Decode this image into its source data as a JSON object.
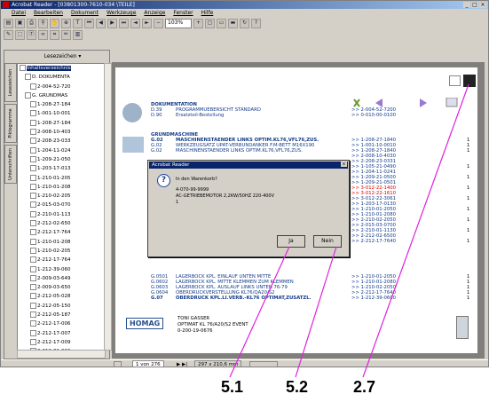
{
  "window": {
    "title": "Acrobat Reader - [03801300-7610-034 \\TEILE]",
    "controls": [
      "_",
      "□",
      "×"
    ]
  },
  "menu": [
    "Datei",
    "Bearbeiten",
    "Dokument",
    "Werkzeuge",
    "Anzeige",
    "Fenster",
    "Hilfe"
  ],
  "toolbar": {
    "zoom": "103%"
  },
  "sidebar": {
    "header": "Lesezeichen ▾",
    "tabs": [
      "Lesezeichen",
      "Piktogramme",
      "Unterschriften"
    ],
    "tree": [
      {
        "label": "Inhaltsverzeichnis",
        "selected": true
      },
      {
        "label": "D. DOKUMENTA"
      },
      {
        "label": "2-004-52-720"
      },
      {
        "label": "G. GRUNDMAS"
      },
      {
        "label": "1-208-27-184"
      },
      {
        "label": "1-001-10-001"
      },
      {
        "label": "1-208-27-184"
      },
      {
        "label": "2-008-10-403"
      },
      {
        "label": "2-208-23-033"
      },
      {
        "label": "1-204-11-024"
      },
      {
        "label": "1-209-21-050"
      },
      {
        "label": "1-203-17-013"
      },
      {
        "label": "1-210-01-205"
      },
      {
        "label": "1-210-01-208"
      },
      {
        "label": "1-210-02-205"
      },
      {
        "label": "2-015-03-070"
      },
      {
        "label": "2-210-01-113"
      },
      {
        "label": "2-212-02-650"
      },
      {
        "label": "2-212-17-764"
      },
      {
        "label": "1-210-01-208"
      },
      {
        "label": "1-210-02-205"
      },
      {
        "label": "2-212-17-764"
      },
      {
        "label": "1-212-39-060"
      },
      {
        "label": "2-009-03-649"
      },
      {
        "label": "2-009-03-650"
      },
      {
        "label": "2-212-05-028"
      },
      {
        "label": "2-212-05-150"
      },
      {
        "label": "2-212-05-187"
      },
      {
        "label": "2-212-17-006"
      },
      {
        "label": "2-212-17-007"
      },
      {
        "label": "2-212-17-009"
      },
      {
        "label": "2-212-31-002"
      },
      {
        "label": "2-212-31-189"
      }
    ]
  },
  "document": {
    "dok_header": "DOKUMENTATION",
    "dok_rows": [
      {
        "code": "D.39",
        "text": "PROGRAMMUEBERSICHT STANDARD",
        "ref": ">> 2-004-52-7200"
      },
      {
        "code": "D.90",
        "text": "Ersatzteil-Bestellung",
        "ref": ">> 0-010-00-0100"
      }
    ],
    "grund_header": "GRUNDMASCHINE",
    "grund_rows": [
      {
        "code": "G.02",
        "text": "MASCHINENSTAENDER LINKS  OPTIM.KL76,VFL76,ZUS.",
        "ref": ">> 1-208-27-1840",
        "qty": "1",
        "bold": true
      },
      {
        "code": "G.02",
        "text": "WERKZEUGSATZ UPAT-VERBUNDANKER F.M-BETT M16X190",
        "ref": ">> 1-001-10-0010",
        "qty": "1"
      },
      {
        "code": "G.02",
        "text": "MASCHINENSTAENDER LINKS  OPTIM.KL76,VFL76,ZUS.",
        "ref": ">> 1-208-27-1840",
        "qty": "1"
      }
    ],
    "right_refs": [
      ">> 2-008-10-4030",
      ">> 2-208-23-0331",
      ">> 1-105-21-0490",
      ">> 1-204-11-0241",
      ">> 1-209-21-0500",
      ">> 1-209-21-0501",
      ">> 3-012-22-1400",
      ">> 3-012-22-1610",
      ">> 3-012-22-3061",
      ">> 1-203-17-0130",
      ">> 1-210-01-2050",
      ">> 1-210-01-2080",
      ">> 2-210-02-2050",
      ">> 2-015-03-0700",
      ">> 2-210-01-1130",
      ">> 2-212-02-6500",
      ">> 2-212-17-7640"
    ],
    "right_qtys": [
      "1",
      "1",
      "1",
      "1",
      "1",
      "1",
      "1",
      "1"
    ],
    "lower_rows": [
      {
        "code": "G.0501",
        "text": "LAGERBOCK KPL. EINLAUF  UNTEN MITTE",
        "ref": ">> 1-210-01-2050",
        "qty": "1"
      },
      {
        "code": "G.0602",
        "text": "LAGERBOCK KPL. MITTE    KLEMMEN ZUM KLEMMEN",
        "ref": ">> 1-210-01-2080",
        "qty": "1"
      },
      {
        "code": "G.0603",
        "text": "LAGERBOCK KPL. AUSLAUF LINKS  UNTEN 76-79",
        "ref": ">> 1-210-02-2050",
        "qty": "1"
      },
      {
        "code": "G.0604",
        "text": "OBERDRUCKVERSTELLUNG  KL76/QA20/S2",
        "ref": ">> 2-212-17-7640",
        "qty": "1"
      },
      {
        "code": "G.07",
        "text": "OBERDRUCK KPL.LI.VERB.-KL76 OPTIMAT,ZUSATZL.",
        "ref": ">> 1-212-39-0600",
        "qty": "1",
        "bold": true
      }
    ],
    "footer_logo": "HOMAG",
    "footer_lines": [
      "TONI GASSER",
      "OPTIMAT KL 76/A20/S2 EVENT",
      "0-200-19-0676"
    ]
  },
  "dialog": {
    "title": "Acrobat Reader",
    "close": "x",
    "lines": [
      "In den Warenkorb?",
      "4-070-99-9999",
      "AC-GETRIEBEMOTOR 2,2KW/50HZ    220-400V",
      "1"
    ],
    "yes": "Ja",
    "no": "Nein"
  },
  "statusbar": {
    "page": "1 von 276",
    "size": "297 x 210,6 mm"
  },
  "callouts": [
    "5.1",
    "5.2",
    "2.7"
  ]
}
